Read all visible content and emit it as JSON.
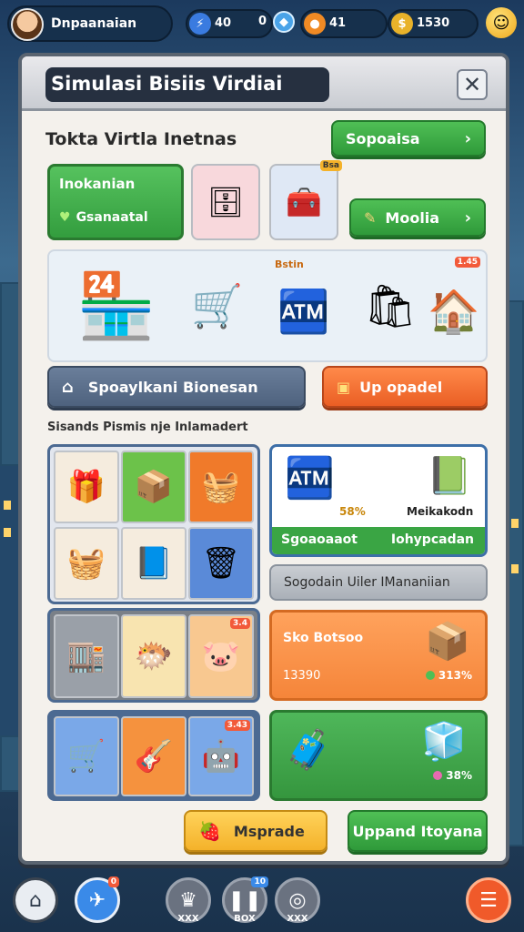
{
  "player": {
    "name": "Dnpaanaian"
  },
  "resources": [
    {
      "icon": "lightning-icon",
      "value": "40",
      "color": "#3a7be0"
    },
    {
      "icon": "gem-icon",
      "value": "0",
      "color": "#4aa3e8"
    },
    {
      "icon": "coin-icon",
      "value": "41",
      "color": "#f08a24"
    },
    {
      "icon": "money-icon",
      "value": "1530",
      "color": "#e8b22a"
    }
  ],
  "modal": {
    "title": "Simulasi Bisiis Virdiai",
    "close_glyph": "✕",
    "subtitle": "Tokta Virtla Inetnas"
  },
  "buttons": {
    "top_right": "Sopoaisa",
    "moolia": "Moolia",
    "spoaylkani": "Spoaylkani Bionesan",
    "upgrade_top": "Up opadel",
    "special_offer": "Sogodain Uiler IMananiian",
    "bottom_yellow": "Msprade",
    "bottom_green": "Uppand Itoyana"
  },
  "card_green": {
    "title": "Inokanian",
    "status": "Gsanaatal"
  },
  "shop_tags": {
    "bstin": "Bstin",
    "top_right_tag": "1.45",
    "coin_tag": "Bsa"
  },
  "section_label": "Sisands Pismis nje Inlamadert",
  "panel_white": {
    "pct": "58%",
    "right_label": "Meikakodn",
    "strip_left": "Sgoaoaaot",
    "strip_right": "Iohypcadan"
  },
  "panel_orange": {
    "title": "Sko Botsoo",
    "value": "13390",
    "pct": "313%"
  },
  "panel_green": {
    "pct": "38%"
  },
  "grid_badges": {
    "a": "3.4",
    "b": "3.43"
  },
  "nav": [
    {
      "icon": "home-icon",
      "label": ""
    },
    {
      "icon": "compass-icon",
      "label": "",
      "badge": "0"
    },
    {
      "icon": "trophy-icon",
      "label": "XXX"
    },
    {
      "icon": "pause-icon",
      "label": "BOX",
      "badge": "10"
    },
    {
      "icon": "settings-icon",
      "label": "XXX"
    },
    {
      "icon": "menu-icon",
      "label": ""
    }
  ],
  "colors": {
    "primary_green": "#3aa544",
    "primary_orange": "#f5853a",
    "slate": "#4e627e",
    "modal_bg": "#f4f1ec"
  }
}
